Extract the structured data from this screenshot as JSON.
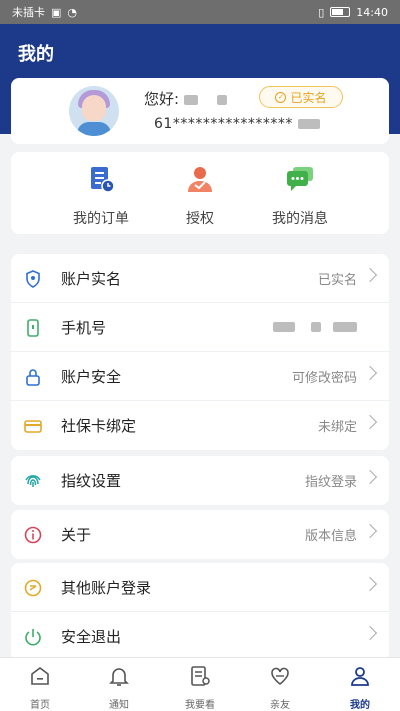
{
  "status_bar": {
    "carrier": "未插卡",
    "time": "14:40"
  },
  "header": {
    "title": "我的"
  },
  "profile": {
    "greeting": "您好:",
    "verified_badge": "已实名",
    "phone_masked": "61****************"
  },
  "quick_actions": [
    {
      "label": "我的订单",
      "icon": "order-icon"
    },
    {
      "label": "授权",
      "icon": "authorize-icon"
    },
    {
      "label": "我的消息",
      "icon": "message-icon"
    }
  ],
  "settings": {
    "account_verify": {
      "label": "账户实名",
      "value": "已实名"
    },
    "phone": {
      "label": "手机号"
    },
    "account_security": {
      "label": "账户安全",
      "value": "可修改密码"
    },
    "social_card": {
      "label": "社保卡绑定",
      "value": "未绑定"
    },
    "fingerprint": {
      "label": "指纹设置",
      "value": "指纹登录"
    },
    "about": {
      "label": "关于",
      "value": "版本信息"
    },
    "other_login": {
      "label": "其他账户登录"
    },
    "logout": {
      "label": "安全退出"
    }
  },
  "tab_bar": [
    {
      "label": "首页",
      "icon": "home-icon"
    },
    {
      "label": "通知",
      "icon": "bell-icon"
    },
    {
      "label": "我要看",
      "icon": "view-icon"
    },
    {
      "label": "亲友",
      "icon": "family-icon"
    },
    {
      "label": "我的",
      "icon": "profile-icon",
      "active": true
    }
  ]
}
